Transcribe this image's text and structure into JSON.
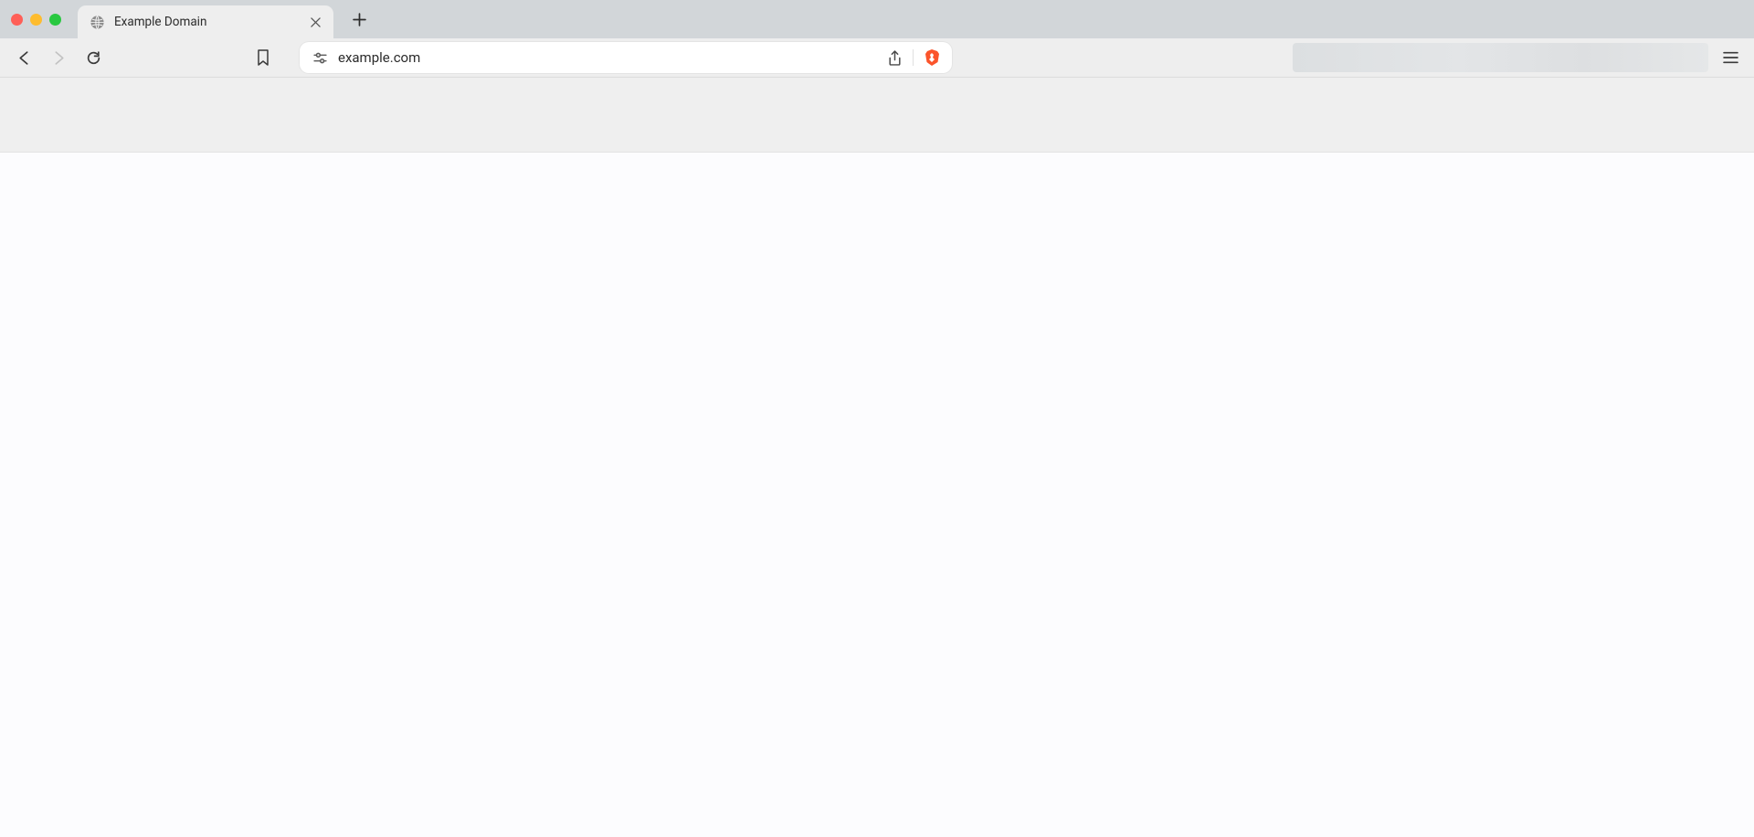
{
  "window": {
    "traffic_lights": [
      "close",
      "minimize",
      "zoom"
    ]
  },
  "tab": {
    "title": "Example Domain",
    "favicon": "globe-icon"
  },
  "toolbar": {
    "url": "example.com",
    "site_settings_icon": "tune-icon",
    "share_icon": "share-icon",
    "shields_icon": "brave-shield-icon"
  }
}
